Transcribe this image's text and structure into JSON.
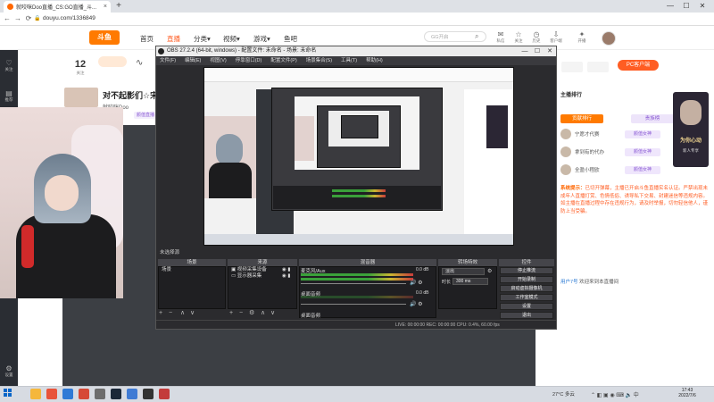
{
  "browser": {
    "tab_title": "就咬咪Doo直播_CS:GO直播_斗...",
    "tab_close": "×",
    "new_tab": "+",
    "url": "douyu.com/1336849",
    "controls": {
      "minimize": "—",
      "maximize": "☐",
      "close": "✕"
    },
    "nav": {
      "back": "←",
      "forward": "→",
      "reload": "⟳"
    }
  },
  "site": {
    "logo": "斗鱼",
    "nav": [
      "首页",
      "直播",
      "分类",
      "视频",
      "游戏",
      "鱼吧"
    ],
    "nav_arrows": [
      "",
      "",
      "▾",
      "▾",
      "▾",
      ""
    ],
    "search_placeholder": "GG开启",
    "header_icons": [
      {
        "icon": "mail-icon",
        "glyph": "✉",
        "label": "私信"
      },
      {
        "icon": "star-icon",
        "glyph": "☆",
        "label": "关注"
      },
      {
        "icon": "history-icon",
        "glyph": "◷",
        "label": "历史"
      },
      {
        "icon": "download-icon",
        "glyph": "⇩",
        "label": "客户端"
      },
      {
        "icon": "bulb-icon",
        "glyph": "✦",
        "label": "开播"
      }
    ],
    "left_sidebar": [
      {
        "icon": "follow-icon",
        "glyph": "♡",
        "label": "关注"
      },
      {
        "icon": "recommend-icon",
        "glyph": "▤",
        "label": "推荐"
      },
      {
        "icon": "settings-icon",
        "glyph": "⚙",
        "label": "设置"
      }
    ]
  },
  "room": {
    "follow_count": "12",
    "follow_label": "关注",
    "title": "对不起影们☆宋了",
    "anchor": "就咬咪Doo",
    "category": "颜值直播"
  },
  "obs": {
    "title": "OBS 27.2.4 (64-bit, windows) - 配置文件: 未命名 - 场景: 未命名",
    "menu": [
      "文件(F)",
      "编辑(E)",
      "视图(V)",
      "停靠窗口(D)",
      "配置文件(P)",
      "场景集合(S)",
      "工具(T)",
      "帮助(H)"
    ],
    "selection_label": "未选择源",
    "docks": {
      "scenes": {
        "header": "场景",
        "items": [
          "场景"
        ]
      },
      "sources": {
        "header": "来源",
        "items": [
          "视频采集设备",
          "显示器采集"
        ]
      },
      "mixer": {
        "header": "混音器",
        "channels": [
          {
            "name": "桌面音频",
            "db": "0.0 dB"
          },
          {
            "name": "麦克风/Aux",
            "db": "0.0 dB"
          },
          {
            "name": "桌面音频",
            "db": ""
          }
        ]
      },
      "transitions": {
        "header": "转场特效",
        "type": "淡出",
        "duration_label": "时长",
        "duration": "300 ms"
      },
      "controls": {
        "header": "控件",
        "buttons": [
          "停止推流",
          "开始录制",
          "启动虚拟摄像机",
          "工作室模式",
          "设置",
          "退出"
        ]
      }
    },
    "tools": {
      "add": "+",
      "remove": "−",
      "up": "∧",
      "down": "∨",
      "gear": "⚙"
    },
    "status": "LIVE: 00:00:00   REC: 00:00:00   CPU: 0.4%, 60.00 fps"
  },
  "right_panel": {
    "pc_button": "PC客户端",
    "rank_title": "主播排行",
    "rank_tabs": [
      "贡献排行",
      "贵族榜"
    ],
    "rank_rows": [
      {
        "name": "宁愿才代赛",
        "badge": "颜值女神"
      },
      {
        "name": "拿到有的代办",
        "badge": "颜值女神"
      },
      {
        "name": "全盈小程欧",
        "badge": "颜值女神"
      }
    ],
    "promo_title": "为你心动",
    "promo_sub": "新人专享",
    "notice_label": "系统提示：",
    "notice": "已切开弹幕，主播已开启斗鱼直播实名认证。严禁出现未成年人直播打赏、色情低俗、诱导私下交易、封建迷信等违规内容。如主播在直播过程中存在违规行为，请及时举报，切勿轻信他人，谨防上当受骗。",
    "chat_user": "用户7号",
    "chat_text": "欢迎来到本直播间"
  },
  "taskbar": {
    "weather": "27°C 多云",
    "time": "17:43",
    "date": "2022/7/6",
    "app_colors": [
      "#f5b73c",
      "#e8533a",
      "#2f7ad6",
      "#d64937",
      "#6d6d6d",
      "#1b2838",
      "#3f7bd4",
      "#333333",
      "#c33b3b"
    ]
  },
  "colors": {
    "brand": "#ff5d23",
    "accent_purple": "#8a5ad4",
    "obs_bg": "#2b2b2e"
  }
}
